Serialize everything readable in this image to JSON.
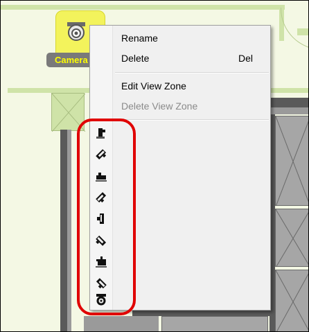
{
  "camera": {
    "label": "Camera"
  },
  "context_menu": {
    "items": [
      {
        "label": "Rename",
        "shortcut": "",
        "enabled": true
      },
      {
        "label": "Delete",
        "shortcut": "Del",
        "enabled": true
      },
      {
        "label": "Edit View Zone",
        "shortcut": "",
        "enabled": true
      },
      {
        "label": "Delete View Zone",
        "shortcut": "",
        "enabled": false
      }
    ],
    "orientation_icons": [
      "camera-facing-down-icon",
      "camera-facing-down-right-icon",
      "camera-facing-right-icon",
      "camera-facing-up-right-icon",
      "camera-facing-up-icon",
      "camera-facing-up-left-icon",
      "camera-facing-left-icon",
      "camera-facing-down-left-icon",
      "dome-camera-icon"
    ]
  },
  "colors": {
    "selection_fill": "#f3f35c",
    "label_text": "#ffff00",
    "highlight": "#e00000",
    "floor": "#f4f8e4",
    "wall": "#cfe3a8"
  }
}
